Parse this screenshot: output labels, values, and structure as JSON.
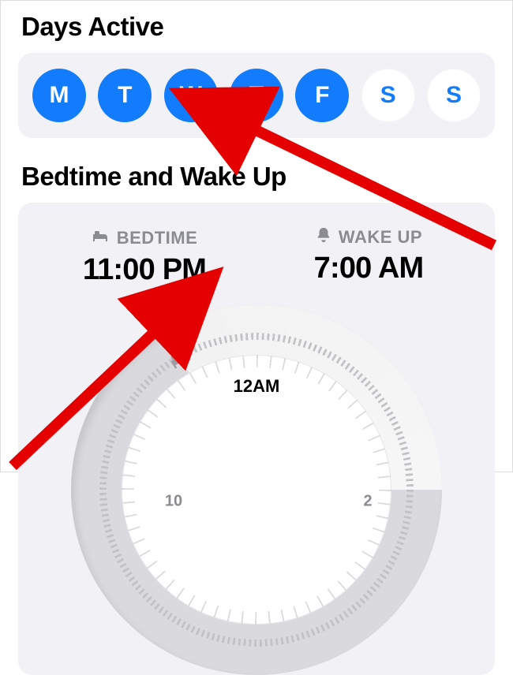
{
  "sections": {
    "days_active": {
      "title": "Days Active"
    },
    "bedtime_wakeup": {
      "title": "Bedtime and Wake Up"
    }
  },
  "days": [
    {
      "label": "M",
      "active": true
    },
    {
      "label": "T",
      "active": true
    },
    {
      "label": "W",
      "active": true
    },
    {
      "label": "T",
      "active": true
    },
    {
      "label": "F",
      "active": true
    },
    {
      "label": "S",
      "active": false
    },
    {
      "label": "S",
      "active": false
    }
  ],
  "sleep": {
    "bedtime_label": "BEDTIME",
    "bedtime_value": "11:00 PM",
    "wakeup_label": "WAKE UP",
    "wakeup_value": "7:00 AM"
  },
  "dial": {
    "top_hour_label": "12AM",
    "visible_hours": {
      "left": "10",
      "right": "2"
    }
  },
  "colors": {
    "accent": "#137cfd",
    "card_bg": "#f1f1f6",
    "dial_track": "#dadade"
  }
}
